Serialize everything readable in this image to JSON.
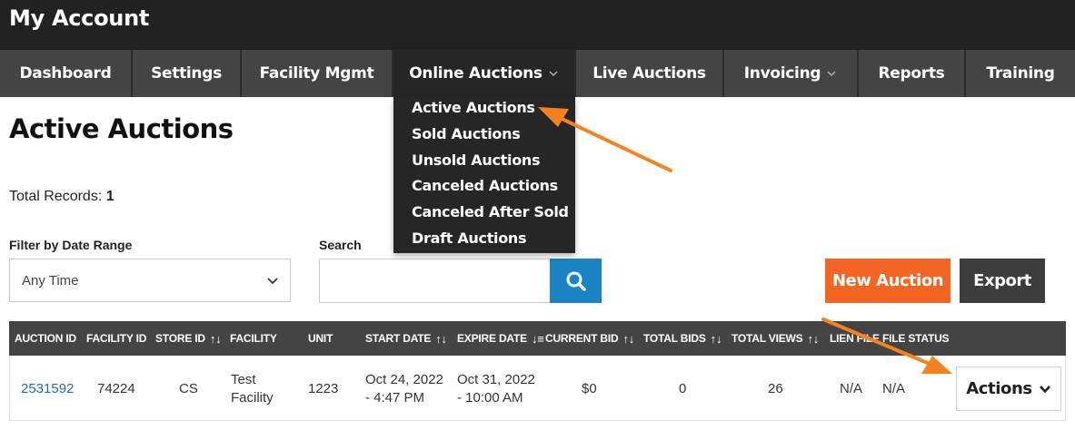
{
  "app": {
    "title": "My Account"
  },
  "nav": {
    "items": [
      {
        "label": "Dashboard"
      },
      {
        "label": "Settings"
      },
      {
        "label": "Facility Mgmt"
      },
      {
        "label": "Online Auctions",
        "active": true,
        "has_dropdown": true
      },
      {
        "label": "Live Auctions"
      },
      {
        "label": "Invoicing",
        "has_dropdown": true
      },
      {
        "label": "Reports"
      },
      {
        "label": "Training"
      }
    ]
  },
  "dropdown": {
    "items": [
      {
        "label": "Active Auctions"
      },
      {
        "label": "Sold Auctions"
      },
      {
        "label": "Unsold Auctions"
      },
      {
        "label": "Canceled Auctions"
      },
      {
        "label": "Canceled After Sold"
      },
      {
        "label": "Draft Auctions"
      }
    ]
  },
  "page": {
    "title": "Active Auctions",
    "total_label": "Total Records:",
    "total_value": "1"
  },
  "filters": {
    "date_label": "Filter by Date Range",
    "date_value": "Any Time",
    "search_label": "Search",
    "search_value": ""
  },
  "buttons": {
    "new_auction": "New Auction",
    "export": "Export",
    "actions": "Actions"
  },
  "table": {
    "columns": [
      {
        "label": "AUCTION ID",
        "sortable": false
      },
      {
        "label": "FACILITY ID",
        "sortable": false
      },
      {
        "label": "STORE ID",
        "sortable": true,
        "sort_glyph": "↑↓"
      },
      {
        "label": "FACILITY",
        "sortable": false
      },
      {
        "label": "UNIT",
        "sortable": false
      },
      {
        "label": "START DATE",
        "sortable": true,
        "sort_glyph": "↑↓"
      },
      {
        "label": "EXPIRE DATE",
        "sortable": true,
        "sort_glyph": "↓≡"
      },
      {
        "label": "CURRENT BID",
        "sortable": true,
        "sort_glyph": "↑↓"
      },
      {
        "label": "TOTAL BIDS",
        "sortable": true,
        "sort_glyph": "↑↓"
      },
      {
        "label": "TOTAL VIEWS",
        "sortable": true,
        "sort_glyph": "↑↓"
      },
      {
        "label": "LIEN FILE",
        "sortable": false
      },
      {
        "label": "FILE STATUS",
        "sortable": false
      }
    ],
    "rows": [
      {
        "auction_id": "2531592",
        "facility_id": "74224",
        "store_id": "CS",
        "facility_line1": "Test",
        "facility_line2": "Facility",
        "unit": "1223",
        "start_line1": "Oct 24, 2022",
        "start_line2": "- 4:47 PM",
        "expire_line1": "Oct 31, 2022",
        "expire_line2": "- 10:00 AM",
        "current_bid": "$0",
        "total_bids": "0",
        "total_views": "26",
        "lien_file": "N/A",
        "file_status": "N/A"
      }
    ]
  },
  "colors": {
    "topbar": "#222222",
    "nav_item": "#444444",
    "nav_active": "#262626",
    "primary_orange": "#f26522",
    "search_blue": "#1a84c5",
    "link_blue": "#1a6fa8",
    "annotation_arrow": "#f5821f"
  },
  "icons": {
    "search": "search-icon",
    "dropdown": "chevron-down-icon"
  }
}
